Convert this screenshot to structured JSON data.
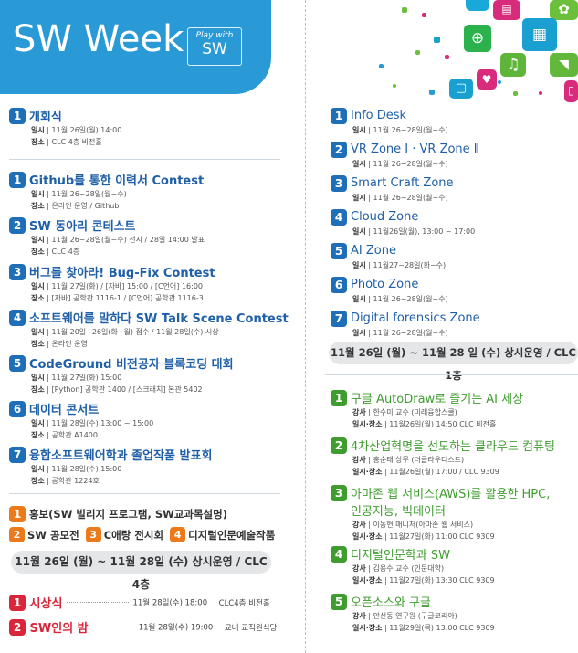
{
  "header": {
    "title": "SW Week",
    "badge_line1": "Play with",
    "badge_line2": "SW"
  },
  "left": {
    "opening": {
      "num": "1",
      "title": "개회식",
      "lines": [
        {
          "k": "일시",
          "v": "11월 26일(월) 14:00"
        },
        {
          "k": "장소",
          "v": "CLC 4층 비전홀"
        }
      ]
    },
    "contests": [
      {
        "num": "1",
        "title": "Github를 통한 이력서 Contest",
        "lines": [
          {
            "k": "일시",
            "v": "11월 26~28일(월~수)"
          },
          {
            "k": "장소",
            "v": "온라인 운영 / Github"
          }
        ]
      },
      {
        "num": "2",
        "title": "SW 동아리 콘테스트",
        "lines": [
          {
            "k": "일시",
            "v": "11월 26~28일(월~수) 전시 / 28일 14:00 발표"
          },
          {
            "k": "장소",
            "v": "CLC 4층"
          }
        ]
      },
      {
        "num": "3",
        "title": "버그를 찾아라! Bug-Fix Contest",
        "lines": [
          {
            "k": "일시",
            "v": "11월 27일(화) / [자바] 15:00 / [C언어] 16:00"
          },
          {
            "k": "장소",
            "v": "[자바] 공학관 1116-1 / [C언어] 공학관 1116-3"
          }
        ]
      },
      {
        "num": "4",
        "title": "소프트웨어를 말하다 SW Talk Scene Contest",
        "lines": [
          {
            "k": "일시",
            "v": "11월 20일~26일(화~월) 접수 / 11월 28일(수) 시상"
          },
          {
            "k": "장소",
            "v": "온라인 운영"
          }
        ]
      },
      {
        "num": "5",
        "title": "CodeGround 비전공자 블록코딩 대회",
        "lines": [
          {
            "k": "일시",
            "v": "11월 27일(화) 15:00"
          },
          {
            "k": "장소",
            "v": "[Python] 공학관 1400 / [스크래치] 본관 5402"
          }
        ]
      },
      {
        "num": "6",
        "title": "데이터 콘서트",
        "lines": [
          {
            "k": "일시",
            "v": "11월 28일(수) 13:00 ~ 15:00"
          },
          {
            "k": "장소",
            "v": "공학관 A1400"
          }
        ]
      },
      {
        "num": "7",
        "title": "융합소프트웨어학과 졸업작품 발표회",
        "lines": [
          {
            "k": "일시",
            "v": "11월 28일(수) 15:00"
          },
          {
            "k": "장소",
            "v": "공학관 1224호"
          }
        ]
      }
    ],
    "promo": [
      {
        "num": "1",
        "label": "홍보(SW 빌리지 프로그램, SW교과목설명)"
      },
      {
        "num": "2",
        "label": "SW 공모전"
      },
      {
        "num": "3",
        "label": "C애랑 전시회"
      },
      {
        "num": "4",
        "label": "디지털인문예술작품"
      }
    ],
    "pill": "11월 26일 (월) ~ 11월 28일 (수) 상시운영 / CLC 4층",
    "ceremonies": [
      {
        "num": "1",
        "label": "시상식",
        "when": "11월 28일(수) 18:00",
        "where": "CLC4층 비전홀"
      },
      {
        "num": "2",
        "label": "SW인의 밤",
        "when": "11월 28일(수) 19:00",
        "where": "교내 교직원식당"
      }
    ]
  },
  "right": {
    "zones": [
      {
        "num": "1",
        "title": "Info Desk",
        "k": "일시",
        "v": "11월 26~28일(월~수)"
      },
      {
        "num": "2",
        "title": "VR Zone Ⅰ · VR Zone Ⅱ",
        "k": "일시",
        "v": "11월 26~28일(월~수)"
      },
      {
        "num": "3",
        "title": "Smart Craft Zone",
        "k": "일시",
        "v": "11월 26~28일(월~수)"
      },
      {
        "num": "4",
        "title": "Cloud Zone",
        "k": "일시",
        "v": "11월26일(월), 13:00 ~ 17:00"
      },
      {
        "num": "5",
        "title": "AI Zone",
        "k": "일시",
        "v": "11월27~28일(화~수)"
      },
      {
        "num": "6",
        "title": "Photo Zone",
        "k": "일시",
        "v": "11월 26~28일(월~수)"
      },
      {
        "num": "7",
        "title": "Digital forensics Zone",
        "k": "일시",
        "v": "11월 26~28일(월~수)"
      }
    ],
    "pill": "11월 26일 (월) ~ 11월 28 일 (수) 상시운영 / CLC 1층",
    "talks": [
      {
        "num": "1",
        "title": "구글 AutoDraw로 즐기는 AI 세상",
        "lines": [
          {
            "k": "강사",
            "v": "한수미 교수 (미래융합스쿨)"
          },
          {
            "k": "일시·장소",
            "v": "11월26일(월) 14:50 CLC 비전홀"
          }
        ]
      },
      {
        "num": "2",
        "title": "4차산업혁명을 선도하는 클라우드 컴퓨팅",
        "lines": [
          {
            "k": "강사",
            "v": "홍순태 상무 (더클라우디스트)"
          },
          {
            "k": "일시·장소",
            "v": "11월26일(월) 17:00 / CLC 9309"
          }
        ]
      },
      {
        "num": "3",
        "title": "아마존 웹 서비스(AWS)를 활용한 HPC,",
        "title2": "인공지능, 빅데이터",
        "lines": [
          {
            "k": "강사",
            "v": "이동현 매니저(아마존 웹 서비스)"
          },
          {
            "k": "일시·장소",
            "v": "11월27일(화) 11:00 CLC 9309"
          }
        ]
      },
      {
        "num": "4",
        "title": "디지털인문학과 SW",
        "lines": [
          {
            "k": "강사",
            "v": "김용수 교수 (인문대학)"
          },
          {
            "k": "일시·장소",
            "v": "11월27일(화) 13:30 CLC 9309"
          }
        ]
      },
      {
        "num": "5",
        "title": "오픈소스와 구글",
        "lines": [
          {
            "k": "강사",
            "v": "안선동 연구원 (구글코리아)"
          },
          {
            "k": "일시·장소",
            "v": "11월29일(목) 13:00 CLC 9309"
          }
        ]
      }
    ]
  },
  "colors": {
    "header_blue": "#2a9ad6",
    "title_blue": "#1e5fa8",
    "green": "#3f9d2f",
    "red": "#d9263a",
    "orange": "#ec7a1a"
  },
  "decor_icons": [
    "chat-icon",
    "contact-card-icon",
    "gear-icon",
    "globe-icon",
    "film-icon",
    "music-icon",
    "rss-icon",
    "tv-icon",
    "heart-icon",
    "phone-icon"
  ]
}
